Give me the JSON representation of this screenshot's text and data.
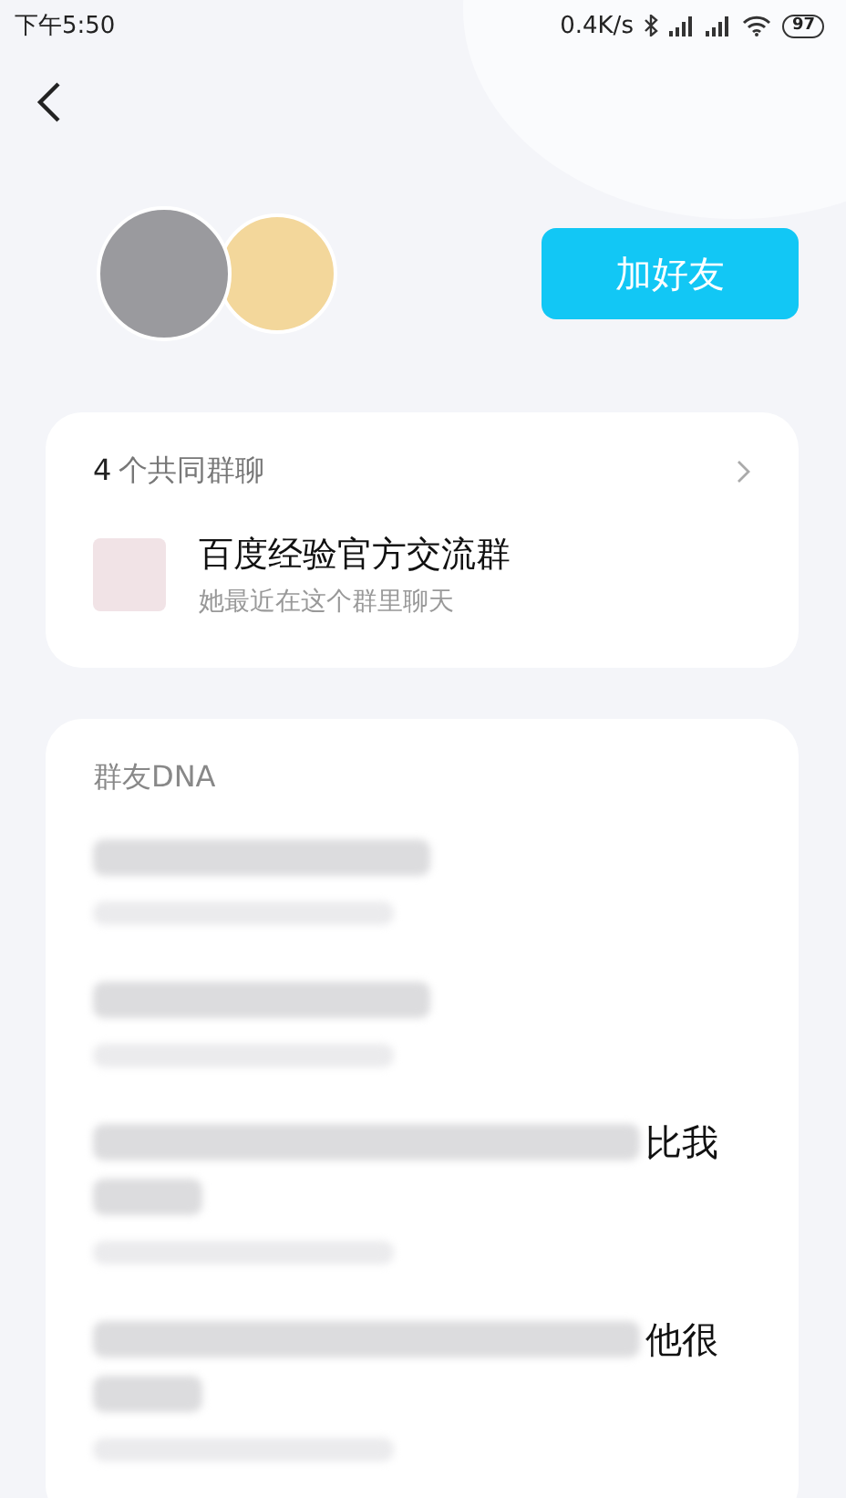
{
  "status_bar": {
    "time": "下午5:50",
    "speed": "0.4K/s",
    "battery": "97"
  },
  "profile": {
    "add_button": "加好友"
  },
  "common_groups": {
    "count": "4",
    "title": "个共同群聊",
    "groups": [
      {
        "name": "百度经验官方交流群",
        "subtitle": "她最近在这个群里聊天"
      }
    ]
  },
  "dna": {
    "title": "群友DNA",
    "items": [
      {
        "kind": "single"
      },
      {
        "kind": "single"
      },
      {
        "kind": "wrapped",
        "visible_tail": "比我"
      },
      {
        "kind": "wrapped",
        "visible_tail": "他很"
      }
    ]
  }
}
